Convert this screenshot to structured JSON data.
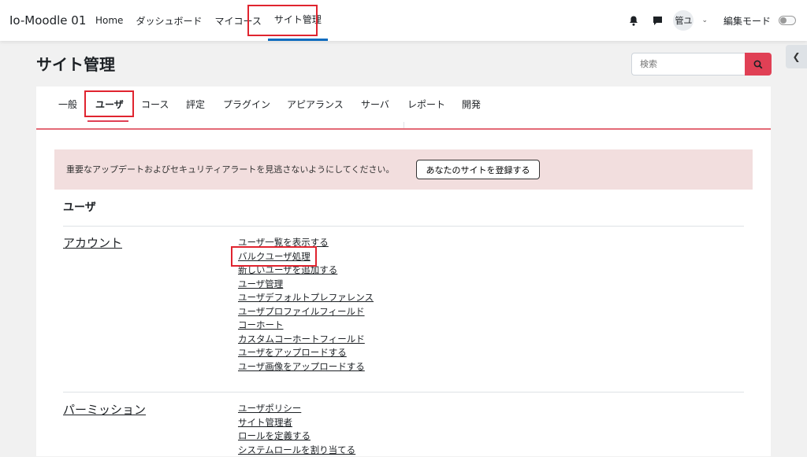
{
  "navbar": {
    "brand": "Io-Moodle 01",
    "links": [
      "Home",
      "ダッシュボード",
      "マイコース",
      "サイト管理"
    ],
    "user_initials": "管ユ",
    "edit_mode_label": "編集モード"
  },
  "page": {
    "title": "サイト管理",
    "search_placeholder": "検索"
  },
  "tabs": [
    "一般",
    "ユーザ",
    "コース",
    "評定",
    "プラグイン",
    "アピアランス",
    "サーバ",
    "レポート",
    "開発"
  ],
  "alert": {
    "text": "重要なアップデートおよびセキュリティアラートを見逃さないようにしてください。",
    "button": "あなたのサイトを登録する"
  },
  "section": {
    "heading": "ユーザ",
    "categories": [
      {
        "title": "アカウント",
        "links": [
          "ユーザ一覧を表示する",
          "バルクユーザ処理",
          "新しいユーザを追加する",
          "ユーザ管理",
          "ユーザデフォルトプレファレンス",
          "ユーザプロファイルフィールド",
          "コーホート",
          "カスタムコーホートフィールド",
          "ユーザをアップロードする",
          "ユーザ画像をアップロードする"
        ]
      },
      {
        "title": "パーミッション",
        "links": [
          "ユーザポリシー",
          "サイト管理者",
          "ロールを定義する",
          "システムロールを割り当てる"
        ]
      }
    ]
  },
  "colors": {
    "accent": "#e04055",
    "highlight": "#e0242f",
    "alert_bg": "#f2dede"
  }
}
